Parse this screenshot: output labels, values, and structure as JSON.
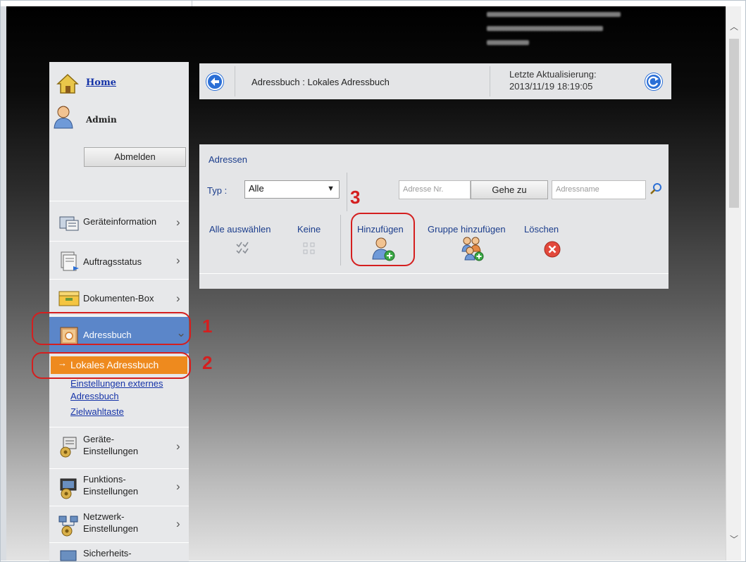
{
  "sidebar": {
    "home_label": "Home",
    "user_label": "Admin",
    "logout_label": "Abmelden",
    "items": [
      {
        "label": "Geräteinformation",
        "icon": "device-info-icon"
      },
      {
        "label": "Auftragsstatus",
        "icon": "job-status-icon"
      },
      {
        "label": "Dokumenten-Box",
        "icon": "document-box-icon"
      },
      {
        "label": "Adressbuch",
        "icon": "address-book-icon"
      },
      {
        "label_line1": "Geräte-",
        "label_line2": "Einstellungen",
        "icon": "device-settings-icon"
      },
      {
        "label_line1": "Funktions-",
        "label_line2": "Einstellungen",
        "icon": "function-settings-icon"
      },
      {
        "label_line1": "Netzwerk-",
        "label_line2": "Einstellungen",
        "icon": "network-settings-icon"
      },
      {
        "label_line1": "Sicherheits-",
        "icon": "security-settings-icon"
      }
    ],
    "sub_items": {
      "active": "Lokales Adressbuch",
      "external_line1": "Einstellungen externes",
      "external_line2": "Adressbuch",
      "speed_dial": "Zielwahltaste"
    }
  },
  "topbar": {
    "title": "Adressbuch : Lokales Adressbuch",
    "update_label": "Letzte Aktualisierung:",
    "update_time": "2013/11/19 18:19:05"
  },
  "panel": {
    "title": "Adressen",
    "type_label": "Typ :",
    "type_value": "Alle",
    "address_no_placeholder": "Adresse Nr.",
    "goto_label": "Gehe zu",
    "address_name_placeholder": "Adressname",
    "actions": {
      "select_all": "Alle auswählen",
      "none": "Keine",
      "add": "Hinzufügen",
      "add_group": "Gruppe hinzufügen",
      "delete": "Löschen"
    }
  },
  "callouts": [
    "1",
    "2",
    "3"
  ],
  "colors": {
    "nav_active": "#5b86c9",
    "sub_active": "#ee8a1e",
    "callout": "#d41f1f",
    "link": "#1533a8"
  }
}
